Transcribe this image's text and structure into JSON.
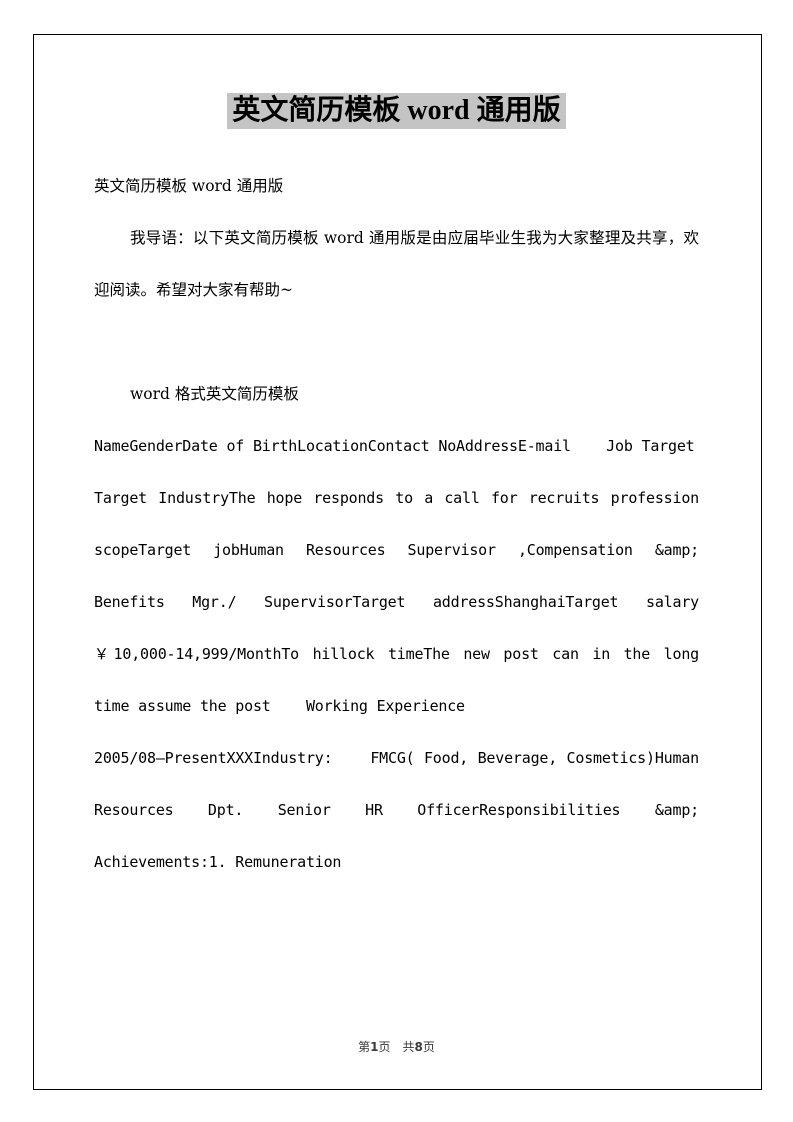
{
  "document": {
    "title": "英文简历模板 word 通用版",
    "title_highlight_color": "#c4c4c4",
    "paragraphs": [
      {
        "id": "p1",
        "lang": "cn",
        "indent": false,
        "text": "英文简历模板 word 通用版"
      },
      {
        "id": "p2",
        "lang": "cn",
        "indent": true,
        "text": "我导语：以下英文简历模板 word 通用版是由应届毕业生我为大家整理及共享，欢迎阅读。希望对大家有帮助~"
      },
      {
        "id": "p3",
        "lang": "cn",
        "indent": true,
        "text": "word 格式英文简历模板"
      },
      {
        "id": "p4",
        "lang": "en",
        "indent": false,
        "text": "NameGenderDate of BirthLocationContact NoAddressE-mail    Job Target"
      },
      {
        "id": "p5",
        "lang": "en",
        "indent": false,
        "text": "Target IndustryThe hope responds to a call for recruits profession scopeTarget jobHuman Resources Supervisor ,Compensation &amp; Benefits Mgr./ SupervisorTarget addressShanghaiTarget salary ￥10,000-14,999/MonthTo hillock timeThe new post can in the long time assume the post    Working Experience"
      },
      {
        "id": "p6",
        "lang": "en",
        "indent": false,
        "text": "2005/08—PresentXXXIndustry:    FMCG( Food, Beverage, Cosmetics)Human Resources Dpt. Senior HR OfficerResponsibilities &amp; Achievements:1. Remuneration"
      }
    ]
  },
  "footer": {
    "page_prefix": "第",
    "page_number": "1",
    "page_suffix": "页",
    "total_prefix": "共",
    "total_pages": "8",
    "total_suffix": "页"
  }
}
